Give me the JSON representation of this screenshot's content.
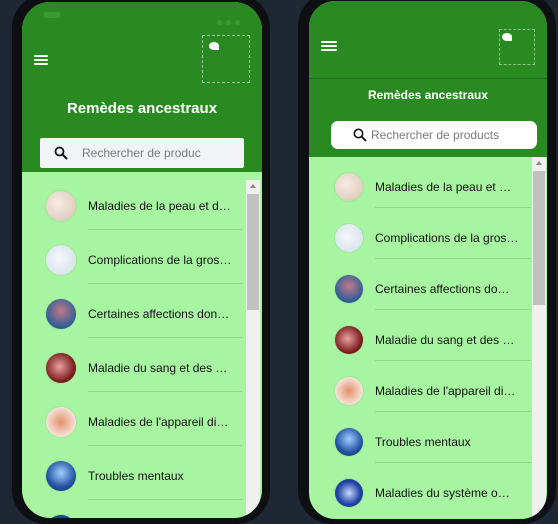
{
  "app": {
    "title": "Remèdes ancestraux"
  },
  "left": {
    "search_placeholder": "Rechercher de produc",
    "items": [
      {
        "label": "Maladies de la peau et d…",
        "icon": "skin-icon",
        "color": "#efe4da"
      },
      {
        "label": "Complications de la gros…",
        "icon": "pregnancy-icon",
        "color": "#e9f0f4"
      },
      {
        "label": "Certaines affections dont…",
        "icon": "infection-icon",
        "color": "#3f6fa6"
      },
      {
        "label": "Maladie du sang et des …",
        "icon": "blood-icon",
        "color": "#7a1b1b"
      },
      {
        "label": "Maladies de l'appareil di…",
        "icon": "digestive-icon",
        "color": "#f0d7cc"
      },
      {
        "label": "Troubles mentaux",
        "icon": "brain-icon",
        "color": "#2552a3"
      }
    ]
  },
  "right": {
    "search_placeholder": "Rechercher de products",
    "items": [
      {
        "label": "Maladies de la peau et …",
        "icon": "skin-icon",
        "color": "#efe4da"
      },
      {
        "label": "Complications de la gros…",
        "icon": "pregnancy-icon",
        "color": "#e9f0f4"
      },
      {
        "label": "Certaines affections do…",
        "icon": "infection-icon",
        "color": "#3f6fa6"
      },
      {
        "label": "Maladie du sang et des …",
        "icon": "blood-icon",
        "color": "#7a1b1b"
      },
      {
        "label": "Maladies de l'appareil di…",
        "icon": "digestive-icon",
        "color": "#f0d7cc"
      },
      {
        "label": "Troubles mentaux",
        "icon": "brain-icon",
        "color": "#2552a3"
      },
      {
        "label": "Maladies du système o…",
        "icon": "nerve-icon",
        "color": "#1c3fa0"
      }
    ]
  },
  "colors": {
    "appbar": "#2a8a22",
    "list_bg": "#a7f5a1",
    "device": "#0d0f12"
  }
}
